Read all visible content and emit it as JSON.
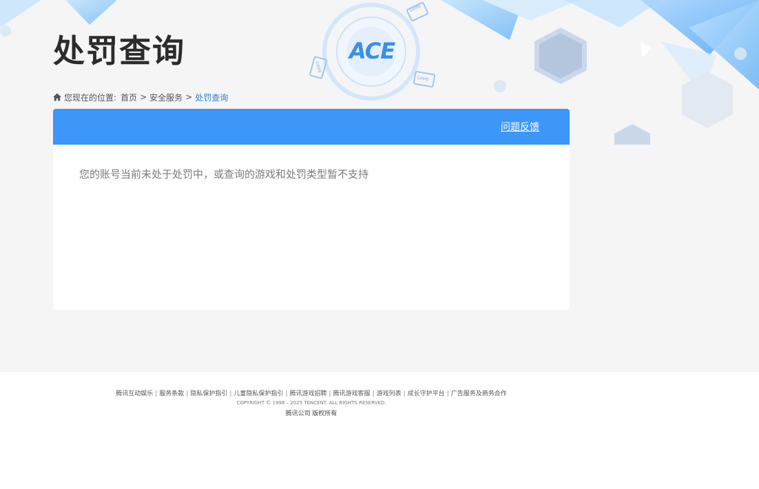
{
  "page": {
    "title": "处罚查询"
  },
  "breadcrumb": {
    "prefix": "您现在的位置:",
    "items": [
      {
        "label": "首页"
      },
      {
        "label": "安全服务"
      },
      {
        "label": "处罚查询"
      }
    ],
    "separator": ">"
  },
  "panel": {
    "feedback_label": "问题反馈",
    "message": "您的账号当前未处于处罚中，或查询的游戏和处罚类型暂不支持"
  },
  "footer": {
    "links": [
      {
        "label": "腾讯互动娱乐"
      },
      {
        "label": "服务条款"
      },
      {
        "label": "隐私保护指引"
      },
      {
        "label": "儿童隐私保护指引"
      },
      {
        "label": "腾讯游戏招聘"
      },
      {
        "label": "腾讯游戏客服"
      },
      {
        "label": "游戏列表"
      },
      {
        "label": "成长守护平台"
      },
      {
        "label": "广告服务及商务合作"
      }
    ],
    "copyright": "COPYRIGHT © 1998 – 2025 TENCENT. ALL RIGHTS RESERVED.",
    "company": "腾讯公司 版权所有"
  },
  "logo": {
    "text": "ACE",
    "badges": [
      "GAME",
      "GAME",
      "GAME"
    ]
  },
  "colors": {
    "header_blue": "#3d97f8",
    "breadcrumb_current": "#2e7fd6",
    "page_bg": "#f5f5f6"
  }
}
